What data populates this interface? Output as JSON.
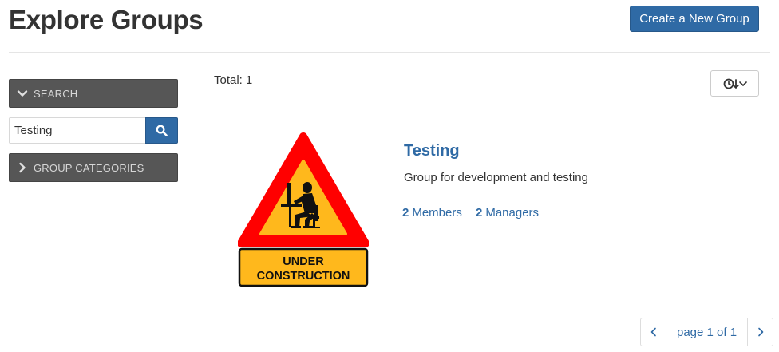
{
  "header": {
    "title": "Explore Groups",
    "create_label": "Create a New Group"
  },
  "sidebar": {
    "search_heading": "SEARCH",
    "search_value": "Testing",
    "categories_heading": "GROUP CATEGORIES"
  },
  "results": {
    "total_label": "Total:",
    "total_count": "1",
    "sort_icon": "clock-sort-icon"
  },
  "group": {
    "image_text_line1": "UNDER",
    "image_text_line2": "CONSTRUCTION",
    "name": "Testing",
    "description": "Group for development and testing",
    "members_count": "2",
    "members_label": "Members",
    "managers_count": "2",
    "managers_label": "Managers"
  },
  "pagination": {
    "label": "page 1 of 1"
  },
  "colors": {
    "accent": "#2f6aa5",
    "sidebar_heading_bg": "#565656",
    "sign_red": "#ff0000",
    "sign_yellow": "#ffb81c"
  }
}
